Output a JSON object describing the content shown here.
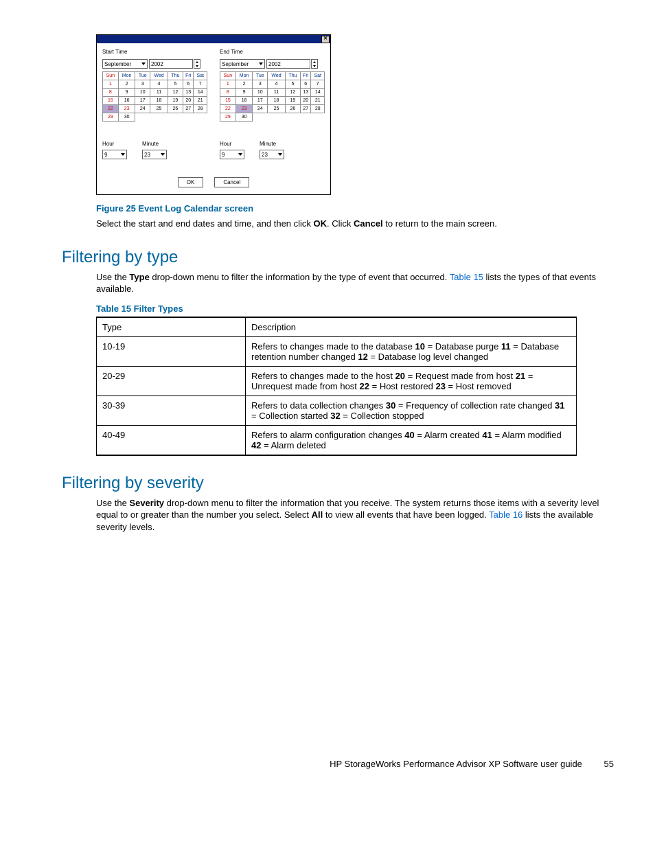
{
  "dialog": {
    "close_glyph": "✕",
    "start": {
      "label": "Start Time",
      "month": "September",
      "year": "2002",
      "hour_label": "Hour",
      "minute_label": "Minute",
      "hour": "9",
      "minute": "23",
      "selected_day": 22,
      "red_day": 23
    },
    "end": {
      "label": "End Time",
      "month": "September",
      "year": "2002",
      "hour_label": "Hour",
      "minute_label": "Minute",
      "hour": "9",
      "minute": "23",
      "selected_day": 23,
      "red_day": 23
    },
    "dow": [
      "Sun",
      "Mon",
      "Tue",
      "Wed",
      "Thu",
      "Fri",
      "Sat"
    ],
    "days_in_month": 30,
    "ok_label": "OK",
    "cancel_label": "Cancel"
  },
  "fig25_caption": "Figure 25 Event Log Calendar screen",
  "fig25_para_a": "Select the start and end dates and time, and then click ",
  "fig25_para_ok": "OK",
  "fig25_para_b": ". Click ",
  "fig25_para_cancel": "Cancel",
  "fig25_para_c": " to return to the main screen.",
  "sec_type_heading": "Filtering by type",
  "type_para_a": "Use the ",
  "type_para_bold": "Type",
  "type_para_b": " drop-down menu to filter the information by the type of event that occurred. ",
  "type_para_xref": "Table 15",
  "type_para_c": " lists the types of that events available.",
  "table15_caption": "Table 15 Filter Types",
  "table15": {
    "head": {
      "c1": "Type",
      "c2": "Description"
    },
    "rows": [
      {
        "c1": "10-19",
        "c2_a": "Refers to changes made to the database ",
        "b1": "10",
        "t1": " = Database purge ",
        "b2": "11",
        "t2": " = Database retention number changed ",
        "b3": "12",
        "t3": " = Database log level changed"
      },
      {
        "c1": "20-29",
        "c2_a": "Refers to changes made to the host ",
        "b1": "20",
        "t1": " = Request made from host ",
        "b2": "21",
        "t2": " = Unrequest made from host ",
        "b3": "22",
        "t3": " = Host restored ",
        "b4": "23",
        "t4": " = Host removed"
      },
      {
        "c1": "30-39",
        "c2_a": "Refers to data collection changes ",
        "b1": "30",
        "t1": " = Frequency of collection rate changed ",
        "b2": "31",
        "t2": " = Collection started ",
        "b3": "32",
        "t3": " = Collection stopped"
      },
      {
        "c1": "40-49",
        "c2_a": "Refers to alarm configuration changes ",
        "b1": "40",
        "t1": " = Alarm created ",
        "b2": "41",
        "t2": " = Alarm modified ",
        "b3": "42",
        "t3": " = Alarm deleted"
      }
    ]
  },
  "sec_sev_heading": "Filtering by severity",
  "sev_para_a": "Use the ",
  "sev_para_bold1": "Severity",
  "sev_para_b": " drop-down menu to filter the information that you receive. The system returns those items with a severity level equal to or greater than the number you select. Select ",
  "sev_para_bold2": "All",
  "sev_para_c": " to view all events that have been logged. ",
  "sev_para_xref": "Table 16",
  "sev_para_d": " lists the available severity levels.",
  "footer_text": "HP StorageWorks Performance Advisor XP Software user guide",
  "footer_page": "55"
}
